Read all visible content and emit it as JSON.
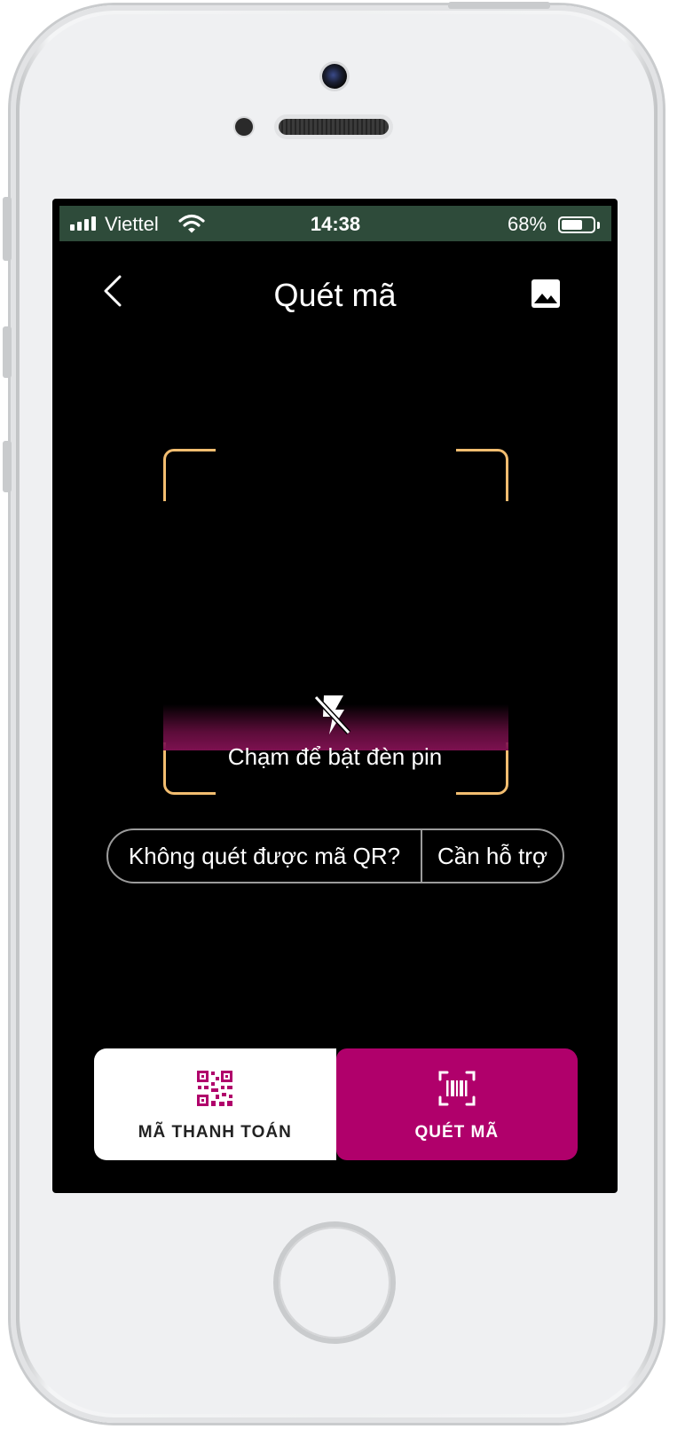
{
  "status_bar": {
    "carrier": "Viettel",
    "time": "14:38",
    "battery_percent": "68%",
    "battery_level": 0.68,
    "signal_bars": 4,
    "background_color": "#2e4b3a"
  },
  "header": {
    "title": "Quét mã",
    "back_icon": "chevron-left-icon",
    "gallery_icon": "image-icon"
  },
  "scanner": {
    "frame_color": "#f2bd70",
    "flash_icon": "flash-off-icon",
    "flash_label": "Chạm để bật đèn pin"
  },
  "help": {
    "question": "Không quét được mã QR?",
    "link": "Cần hỗ trợ"
  },
  "tabs": [
    {
      "label": "MÃ THANH TOÁN",
      "icon": "qr-code-icon",
      "active": false
    },
    {
      "label": "QUÉT MÃ",
      "icon": "barcode-scan-icon",
      "active": true
    }
  ],
  "colors": {
    "accent": "#b0006b",
    "screen_background": "#000000"
  }
}
